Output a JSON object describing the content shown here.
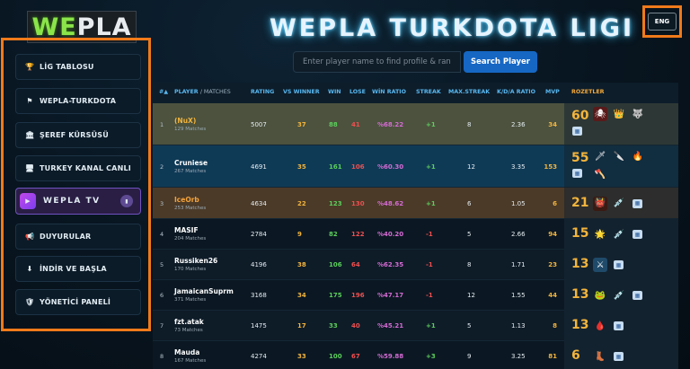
{
  "logo": {
    "green": "WE",
    "white": "PLA"
  },
  "title": "WEPLA TURKDOTA LIGI",
  "lang": "ENG",
  "search": {
    "placeholder": "Enter player name to find profile & rank...",
    "button": "Search Player"
  },
  "sidebar": [
    {
      "icon": "trophy-icon",
      "glyph": "🏆",
      "label": "LİG TABLOSU"
    },
    {
      "icon": "flag-icon",
      "glyph": "⚑",
      "label": "WEPLA-TURKDOTA"
    },
    {
      "icon": "bank-icon",
      "glyph": "🏛",
      "label": "ŞEREF KÜRSÜSÜ"
    },
    {
      "icon": "tv-icon",
      "glyph": "🖥",
      "label": "TURKEY KANAL CANLI"
    },
    {
      "icon": "play-icon",
      "glyph": "▶",
      "label": "WEPLA TV"
    },
    {
      "icon": "megaphone-icon",
      "glyph": "📢",
      "label": "DUYURULAR"
    },
    {
      "icon": "download-icon",
      "glyph": "⬇",
      "label": "İNDİR VE BAŞLA"
    },
    {
      "icon": "shield-icon",
      "glyph": "🛡",
      "label": "YÖNETİCİ PANELİ"
    }
  ],
  "headers": {
    "rank": "#▲",
    "player": "PLAYER",
    "matches": "/ MATCHES",
    "rating": "RATING",
    "vswinner": "VS WINNER",
    "win": "WIN",
    "lose": "LOSE",
    "winratio": "WİN RATIO",
    "streak": "STREAK",
    "maxstreak": "MAX.STREAK",
    "kda": "K/D/A RATIO",
    "mvp": "MVP",
    "rozetler": "ROZETLER"
  },
  "rows": [
    {
      "rank": "1",
      "name": "(NuX)",
      "matches": "129 Matches",
      "rating": "5007",
      "vs": "37",
      "win": "88",
      "lose": "41",
      "ratio": "%68.22",
      "streak": "+1",
      "max": "8",
      "kda": "2.36",
      "mvp": "34",
      "badge_count": "60",
      "badges": [
        "spider-icon",
        "crown-icon",
        "wolf-icon",
        "calendar-icon"
      ]
    },
    {
      "rank": "2",
      "name": "Cruniese",
      "matches": "267 Matches",
      "rating": "4691",
      "vs": "35",
      "win": "161",
      "lose": "106",
      "ratio": "%60.30",
      "streak": "+1",
      "max": "12",
      "kda": "3.35",
      "mvp": "153",
      "badge_count": "55",
      "badges": [
        "spear-icon",
        "dagger-icon",
        "flame-icon",
        "axe-icon",
        "calendar-icon"
      ]
    },
    {
      "rank": "3",
      "name": "IceOrb",
      "matches": "253 Matches",
      "rating": "4634",
      "vs": "22",
      "win": "123",
      "lose": "130",
      "ratio": "%48.62",
      "streak": "+1",
      "max": "6",
      "kda": "1.05",
      "mvp": "6",
      "badge_count": "21",
      "badges": [
        "demon-icon",
        "syringe-icon",
        "calendar-icon"
      ]
    },
    {
      "rank": "4",
      "name": "MASIF",
      "matches": "204 Matches",
      "rating": "2784",
      "vs": "9",
      "win": "82",
      "lose": "122",
      "ratio": "%40.20",
      "streak": "-1",
      "max": "5",
      "kda": "2.66",
      "mvp": "94",
      "badge_count": "15",
      "badges": [
        "sun-icon",
        "syringe-icon",
        "calendar-icon"
      ]
    },
    {
      "rank": "5",
      "name": "Russiken26",
      "matches": "170 Matches",
      "rating": "4196",
      "vs": "38",
      "win": "106",
      "lose": "64",
      "ratio": "%62.35",
      "streak": "-1",
      "max": "8",
      "kda": "1.71",
      "mvp": "23",
      "badge_count": "13",
      "badges": [
        "crossed-swords-icon",
        "calendar-icon"
      ]
    },
    {
      "rank": "6",
      "name": "JamaicanSuprm",
      "matches": "371 Matches",
      "rating": "3168",
      "vs": "34",
      "win": "175",
      "lose": "196",
      "ratio": "%47.17",
      "streak": "-1",
      "max": "12",
      "kda": "1.55",
      "mvp": "44",
      "badge_count": "13",
      "badges": [
        "frog-icon",
        "syringe-icon",
        "calendar-icon"
      ]
    },
    {
      "rank": "7",
      "name": "fzt.atak",
      "matches": "73 Matches",
      "rating": "1475",
      "vs": "17",
      "win": "33",
      "lose": "40",
      "ratio": "%45.21",
      "streak": "+1",
      "max": "5",
      "kda": "1.13",
      "mvp": "8",
      "badge_count": "13",
      "badges": [
        "blood-drop-icon",
        "calendar-icon"
      ]
    },
    {
      "rank": "8",
      "name": "Mauda",
      "matches": "167 Matches",
      "rating": "4274",
      "vs": "33",
      "win": "100",
      "lose": "67",
      "ratio": "%59.88",
      "streak": "+3",
      "max": "9",
      "kda": "3.25",
      "mvp": "81",
      "badge_count": "6",
      "badges": [
        "boot-icon",
        "calendar-icon"
      ]
    }
  ],
  "colors": {
    "accent": "#58b7f0",
    "highlight_orange": "#f07a1a",
    "gold": "#f3b43c",
    "win": "#5ccf5c",
    "lose": "#ef4f4f",
    "ratio": "#d56bd4",
    "purple_btn": "#7b3ff0"
  }
}
